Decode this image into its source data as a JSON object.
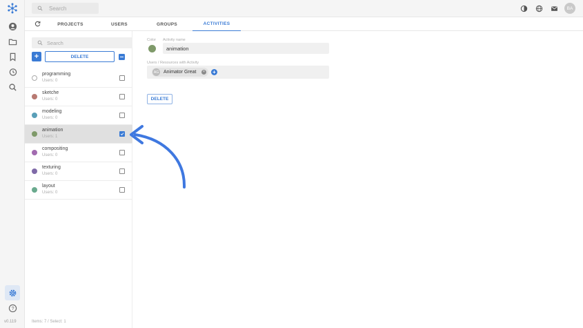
{
  "topbar": {
    "search_placeholder": "Search",
    "avatar_initials": "BA"
  },
  "tabs": [
    {
      "label": "PROJECTS"
    },
    {
      "label": "USERS"
    },
    {
      "label": "GROUPS"
    },
    {
      "label": "ACTIVITIES",
      "active": true
    }
  ],
  "panel": {
    "search_placeholder": "Search",
    "add_label": "+",
    "delete_label": "DELETE",
    "items": [
      {
        "name": "programming",
        "users": "Users: 0",
        "color": "#ffffff",
        "checked": false
      },
      {
        "name": "sketche",
        "users": "Users: 0",
        "color": "#b87a72",
        "checked": false
      },
      {
        "name": "modeling",
        "users": "Users: 0",
        "color": "#5a9fb8",
        "checked": false
      },
      {
        "name": "animation",
        "users": "Users: 1",
        "color": "#7f9a6a",
        "checked": true
      },
      {
        "name": "compositing",
        "users": "Users: 0",
        "color": "#a26bb0",
        "checked": false
      },
      {
        "name": "texturing",
        "users": "Users: 0",
        "color": "#7f6aa8",
        "checked": false
      },
      {
        "name": "layout",
        "users": "Users: 0",
        "color": "#6aaa8e",
        "checked": false
      }
    ]
  },
  "detail": {
    "color_label": "Color",
    "name_label": "Activity name",
    "name_value": "animation",
    "color_value": "#7f9a6a",
    "users_label": "Users / Resources with Activity",
    "chip_initials": "AG",
    "chip_name": "Animator Great",
    "delete_label": "DELETE"
  },
  "status": "Items: 7 / Select: 1",
  "version": "v0.119",
  "accent": "#3a7bd5"
}
